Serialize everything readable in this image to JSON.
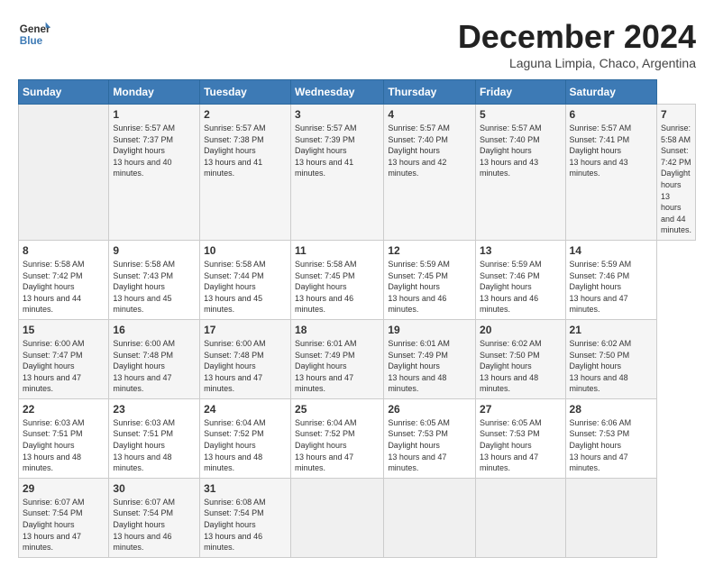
{
  "header": {
    "logo_line1": "General",
    "logo_line2": "Blue",
    "month": "December 2024",
    "location": "Laguna Limpia, Chaco, Argentina"
  },
  "calendar": {
    "days_of_week": [
      "Sunday",
      "Monday",
      "Tuesday",
      "Wednesday",
      "Thursday",
      "Friday",
      "Saturday"
    ],
    "weeks": [
      [
        null,
        {
          "day": "1",
          "sunrise": "5:57 AM",
          "sunset": "7:37 PM",
          "daylight": "13 hours and 40 minutes."
        },
        {
          "day": "2",
          "sunrise": "5:57 AM",
          "sunset": "7:38 PM",
          "daylight": "13 hours and 41 minutes."
        },
        {
          "day": "3",
          "sunrise": "5:57 AM",
          "sunset": "7:39 PM",
          "daylight": "13 hours and 41 minutes."
        },
        {
          "day": "4",
          "sunrise": "5:57 AM",
          "sunset": "7:40 PM",
          "daylight": "13 hours and 42 minutes."
        },
        {
          "day": "5",
          "sunrise": "5:57 AM",
          "sunset": "7:40 PM",
          "daylight": "13 hours and 43 minutes."
        },
        {
          "day": "6",
          "sunrise": "5:57 AM",
          "sunset": "7:41 PM",
          "daylight": "13 hours and 43 minutes."
        },
        {
          "day": "7",
          "sunrise": "5:58 AM",
          "sunset": "7:42 PM",
          "daylight": "13 hours and 44 minutes."
        }
      ],
      [
        {
          "day": "8",
          "sunrise": "5:58 AM",
          "sunset": "7:42 PM",
          "daylight": "13 hours and 44 minutes."
        },
        {
          "day": "9",
          "sunrise": "5:58 AM",
          "sunset": "7:43 PM",
          "daylight": "13 hours and 45 minutes."
        },
        {
          "day": "10",
          "sunrise": "5:58 AM",
          "sunset": "7:44 PM",
          "daylight": "13 hours and 45 minutes."
        },
        {
          "day": "11",
          "sunrise": "5:58 AM",
          "sunset": "7:45 PM",
          "daylight": "13 hours and 46 minutes."
        },
        {
          "day": "12",
          "sunrise": "5:59 AM",
          "sunset": "7:45 PM",
          "daylight": "13 hours and 46 minutes."
        },
        {
          "day": "13",
          "sunrise": "5:59 AM",
          "sunset": "7:46 PM",
          "daylight": "13 hours and 46 minutes."
        },
        {
          "day": "14",
          "sunrise": "5:59 AM",
          "sunset": "7:46 PM",
          "daylight": "13 hours and 47 minutes."
        }
      ],
      [
        {
          "day": "15",
          "sunrise": "6:00 AM",
          "sunset": "7:47 PM",
          "daylight": "13 hours and 47 minutes."
        },
        {
          "day": "16",
          "sunrise": "6:00 AM",
          "sunset": "7:48 PM",
          "daylight": "13 hours and 47 minutes."
        },
        {
          "day": "17",
          "sunrise": "6:00 AM",
          "sunset": "7:48 PM",
          "daylight": "13 hours and 47 minutes."
        },
        {
          "day": "18",
          "sunrise": "6:01 AM",
          "sunset": "7:49 PM",
          "daylight": "13 hours and 47 minutes."
        },
        {
          "day": "19",
          "sunrise": "6:01 AM",
          "sunset": "7:49 PM",
          "daylight": "13 hours and 48 minutes."
        },
        {
          "day": "20",
          "sunrise": "6:02 AM",
          "sunset": "7:50 PM",
          "daylight": "13 hours and 48 minutes."
        },
        {
          "day": "21",
          "sunrise": "6:02 AM",
          "sunset": "7:50 PM",
          "daylight": "13 hours and 48 minutes."
        }
      ],
      [
        {
          "day": "22",
          "sunrise": "6:03 AM",
          "sunset": "7:51 PM",
          "daylight": "13 hours and 48 minutes."
        },
        {
          "day": "23",
          "sunrise": "6:03 AM",
          "sunset": "7:51 PM",
          "daylight": "13 hours and 48 minutes."
        },
        {
          "day": "24",
          "sunrise": "6:04 AM",
          "sunset": "7:52 PM",
          "daylight": "13 hours and 48 minutes."
        },
        {
          "day": "25",
          "sunrise": "6:04 AM",
          "sunset": "7:52 PM",
          "daylight": "13 hours and 47 minutes."
        },
        {
          "day": "26",
          "sunrise": "6:05 AM",
          "sunset": "7:53 PM",
          "daylight": "13 hours and 47 minutes."
        },
        {
          "day": "27",
          "sunrise": "6:05 AM",
          "sunset": "7:53 PM",
          "daylight": "13 hours and 47 minutes."
        },
        {
          "day": "28",
          "sunrise": "6:06 AM",
          "sunset": "7:53 PM",
          "daylight": "13 hours and 47 minutes."
        }
      ],
      [
        {
          "day": "29",
          "sunrise": "6:07 AM",
          "sunset": "7:54 PM",
          "daylight": "13 hours and 47 minutes."
        },
        {
          "day": "30",
          "sunrise": "6:07 AM",
          "sunset": "7:54 PM",
          "daylight": "13 hours and 46 minutes."
        },
        {
          "day": "31",
          "sunrise": "6:08 AM",
          "sunset": "7:54 PM",
          "daylight": "13 hours and 46 minutes."
        },
        null,
        null,
        null,
        null
      ]
    ]
  }
}
